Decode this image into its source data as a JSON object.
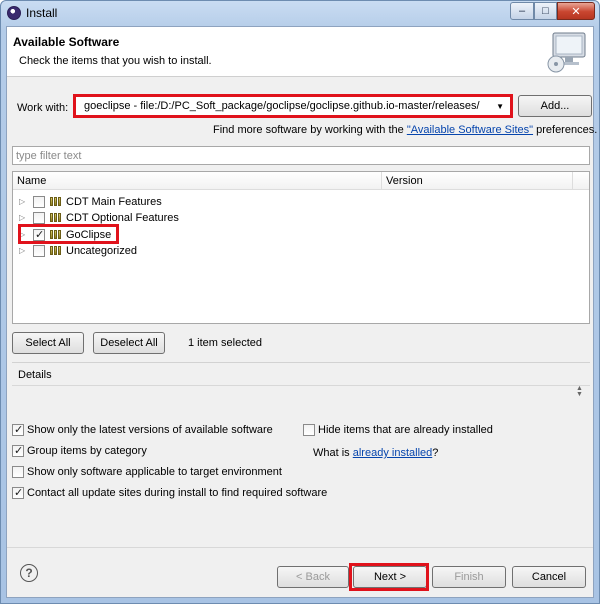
{
  "window": {
    "title": "Install",
    "minimize": "–",
    "maximize": "□",
    "close": "✕"
  },
  "header": {
    "title": "Available Software",
    "description": "Check the items that you wish to install."
  },
  "work_with": {
    "label": "Work with:",
    "value": "goeclipse - file:/D:/PC_Soft_package/goclipse/goclipse.github.io-master/releases/",
    "add_button": "Add..."
  },
  "more_software": {
    "prefix": "Find more software by working with the",
    "link": "\"Available Software Sites\"",
    "suffix": "preferences."
  },
  "filter": {
    "placeholder": "type filter text"
  },
  "table": {
    "columns": [
      "Name",
      "Version"
    ],
    "rows": [
      {
        "label": "CDT Main Features",
        "checked": false
      },
      {
        "label": "CDT Optional Features",
        "checked": false
      },
      {
        "label": "GoClipse",
        "checked": true
      },
      {
        "label": "Uncategorized",
        "checked": false
      }
    ]
  },
  "selection": {
    "select_all": "Select All",
    "deselect_all": "Deselect All",
    "count": "1 item selected"
  },
  "details": {
    "label": "Details"
  },
  "options": {
    "latest_versions": "Show only the latest versions of available software",
    "group_by_category": "Group items by category",
    "applicable_only": "Show only software applicable to target environment",
    "contact_sites": "Contact all update sites during install to find required software",
    "hide_installed": "Hide items that are already installed",
    "what_is": "What is",
    "already_installed": "already installed",
    "question_mark": "?"
  },
  "footer": {
    "help": "?",
    "back": "< Back",
    "next": "Next >",
    "finish": "Finish",
    "cancel": "Cancel"
  },
  "colors": {
    "highlight": "#e0121b",
    "link": "#0645ad",
    "title_bar": "#b4cce8"
  }
}
